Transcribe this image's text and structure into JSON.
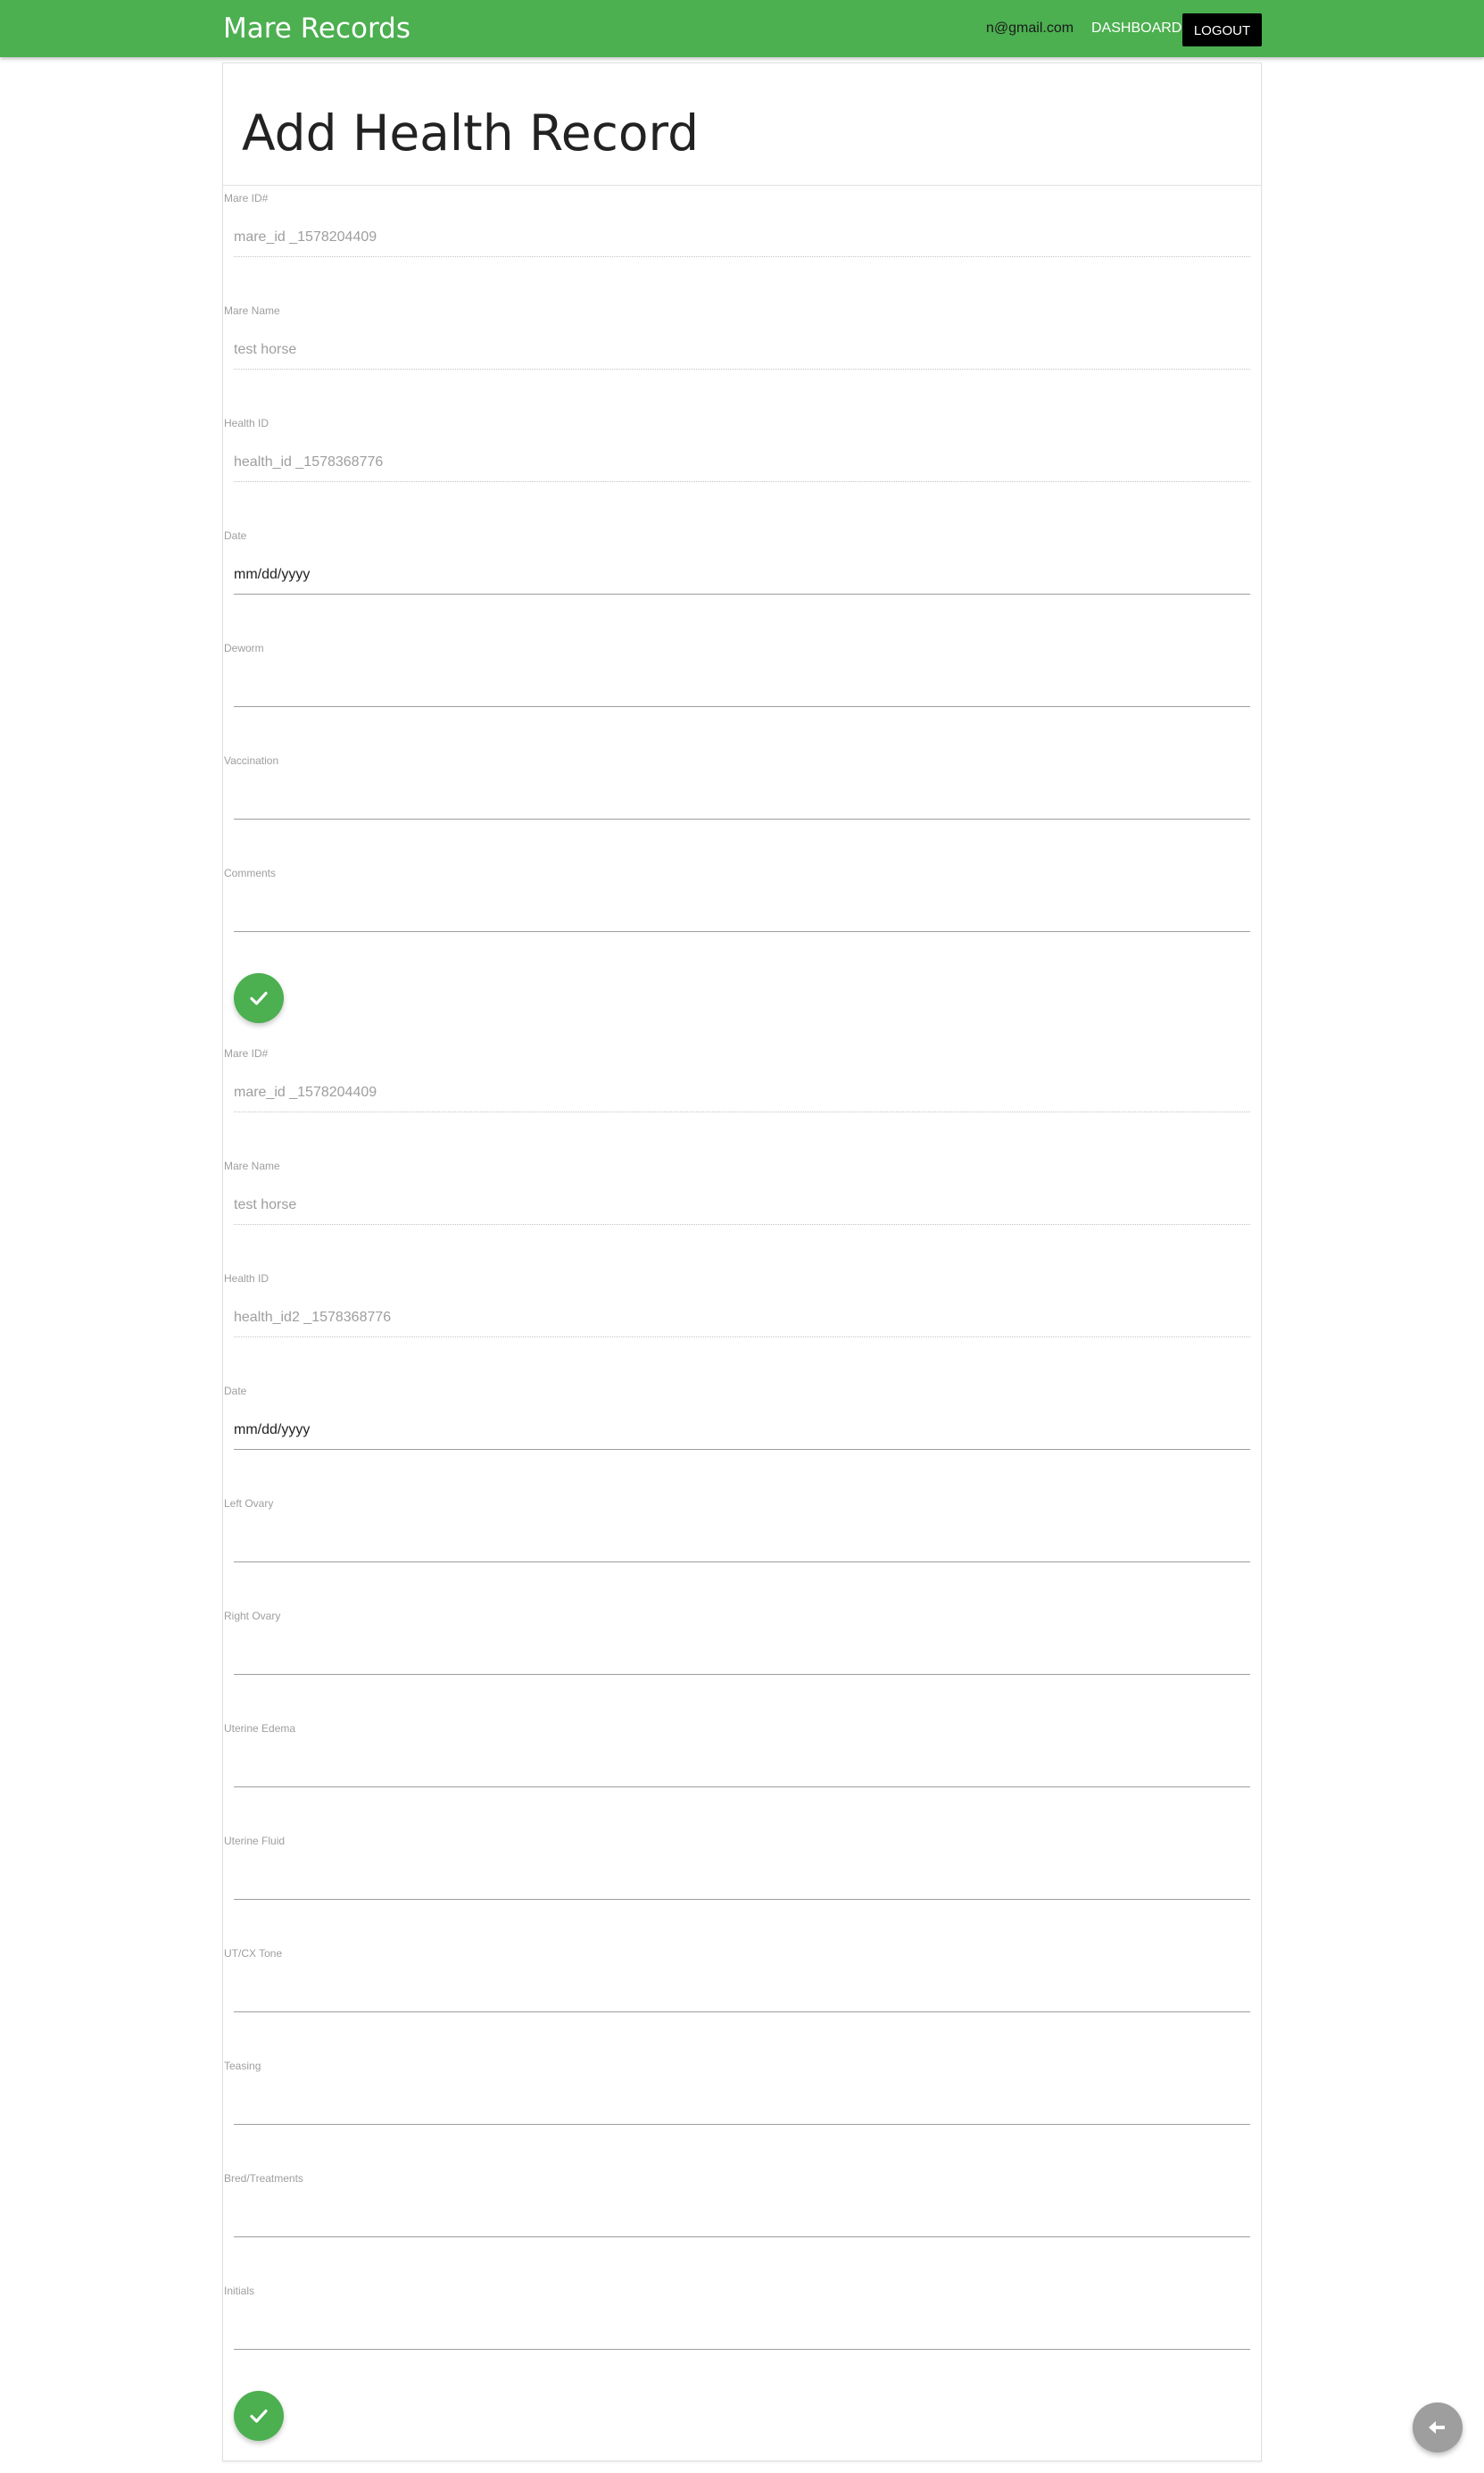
{
  "navbar": {
    "brand": "Mare Records",
    "email": "n@gmail.com",
    "dashboard_label": "DASHBOARD",
    "logout_label": "LOGOUT",
    "color": "#4caf50"
  },
  "page": {
    "title": "Add Health Record"
  },
  "health_form": {
    "fields": [
      {
        "label": "Mare ID#",
        "value": "mare_id _1578204409"
      },
      {
        "label": "Mare Name",
        "value": "test horse"
      },
      {
        "label": "Health ID",
        "value": "health_id _1578368776"
      },
      {
        "label": "Date",
        "value": "mm/dd/yyyy"
      },
      {
        "label": "Deworm",
        "value": ""
      },
      {
        "label": "Vaccination",
        "value": ""
      },
      {
        "label": "Comments",
        "value": ""
      }
    ],
    "submit_icon": "check-icon"
  },
  "repro_form": {
    "fields": [
      {
        "label": "Mare ID#",
        "value": "mare_id _1578204409"
      },
      {
        "label": "Mare Name",
        "value": "test horse"
      },
      {
        "label": "Health ID",
        "value": "health_id2 _1578368776"
      },
      {
        "label": "Date",
        "value": "mm/dd/yyyy"
      },
      {
        "label": "Left Ovary",
        "value": ""
      },
      {
        "label": "Right Ovary",
        "value": ""
      },
      {
        "label": "Uterine Edema",
        "value": ""
      },
      {
        "label": "Uterine Fluid",
        "value": ""
      },
      {
        "label": "UT/CX Tone",
        "value": ""
      },
      {
        "label": "Teasing",
        "value": ""
      },
      {
        "label": "Bred/Treatments",
        "value": ""
      },
      {
        "label": "Initials",
        "value": ""
      }
    ],
    "submit_icon": "check-icon"
  },
  "back_button": {
    "icon": "arrow-left-icon",
    "color": "#9e9e9e"
  }
}
